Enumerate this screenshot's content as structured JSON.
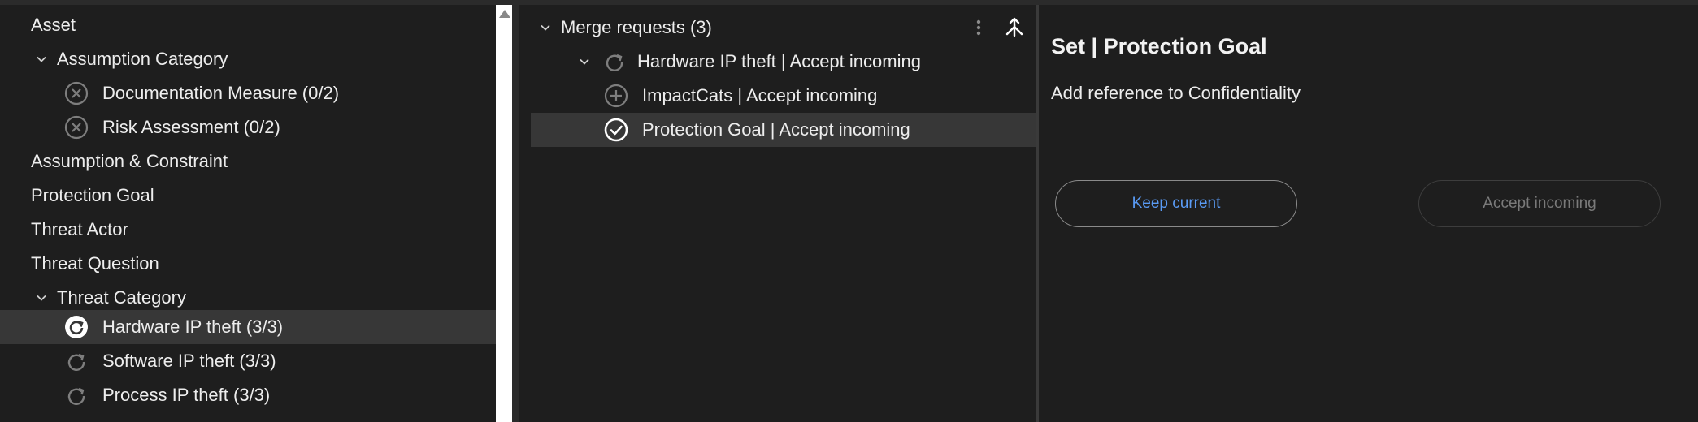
{
  "tree": {
    "items": [
      {
        "label": "Asset",
        "level": 0,
        "chevron": false,
        "icon": null
      },
      {
        "label": "Assumption Category",
        "level": 0,
        "chevron": "down-chevron-icon",
        "icon": null
      },
      {
        "label": "Documentation Measure (0/2)",
        "level": 1,
        "chevron": false,
        "icon": "x-circle-icon"
      },
      {
        "label": "Risk Assessment (0/2)",
        "level": 1,
        "chevron": false,
        "icon": "x-circle-icon"
      },
      {
        "label": "Assumption & Constraint",
        "level": 0,
        "chevron": false,
        "icon": null
      },
      {
        "label": "Protection Goal",
        "level": 0,
        "chevron": false,
        "icon": null
      },
      {
        "label": "Threat Actor",
        "level": 0,
        "chevron": false,
        "icon": null
      },
      {
        "label": "Threat Question",
        "level": 0,
        "chevron": false,
        "icon": null
      },
      {
        "label": "Threat Category",
        "level": 0,
        "chevron": "down-chevron-icon",
        "icon": null
      },
      {
        "label": "Hardware IP theft (3/3)",
        "level": 1,
        "chevron": false,
        "icon": "refresh-circle-icon",
        "selected": true
      },
      {
        "label": "Software IP theft (3/3)",
        "level": 1,
        "chevron": false,
        "icon": "refresh-circle-icon"
      },
      {
        "label": "Process IP theft (3/3)",
        "level": 1,
        "chevron": false,
        "icon": "refresh-circle-icon"
      }
    ]
  },
  "merge": {
    "header": "Merge requests (3)",
    "items": [
      {
        "label": "Hardware IP theft | Accept incoming",
        "icon": "refresh-icon"
      },
      {
        "label": "ImpactCats | Accept incoming",
        "icon": "plus-circle-icon"
      },
      {
        "label": "Protection Goal | Accept incoming",
        "icon": "check-circle-icon",
        "selected": true
      }
    ],
    "tools": {
      "more": "more-vertical-icon",
      "merge": "merge-icon"
    }
  },
  "detail": {
    "title": "Set | Protection Goal",
    "description": "Add reference to Confidentiality",
    "keep_label": "Keep current",
    "accept_label": "Accept incoming"
  },
  "colors": {
    "background": "#1e1e1e",
    "selection": "#373737",
    "link_blue": "#5a9bf5",
    "muted": "#7a7a7a"
  }
}
